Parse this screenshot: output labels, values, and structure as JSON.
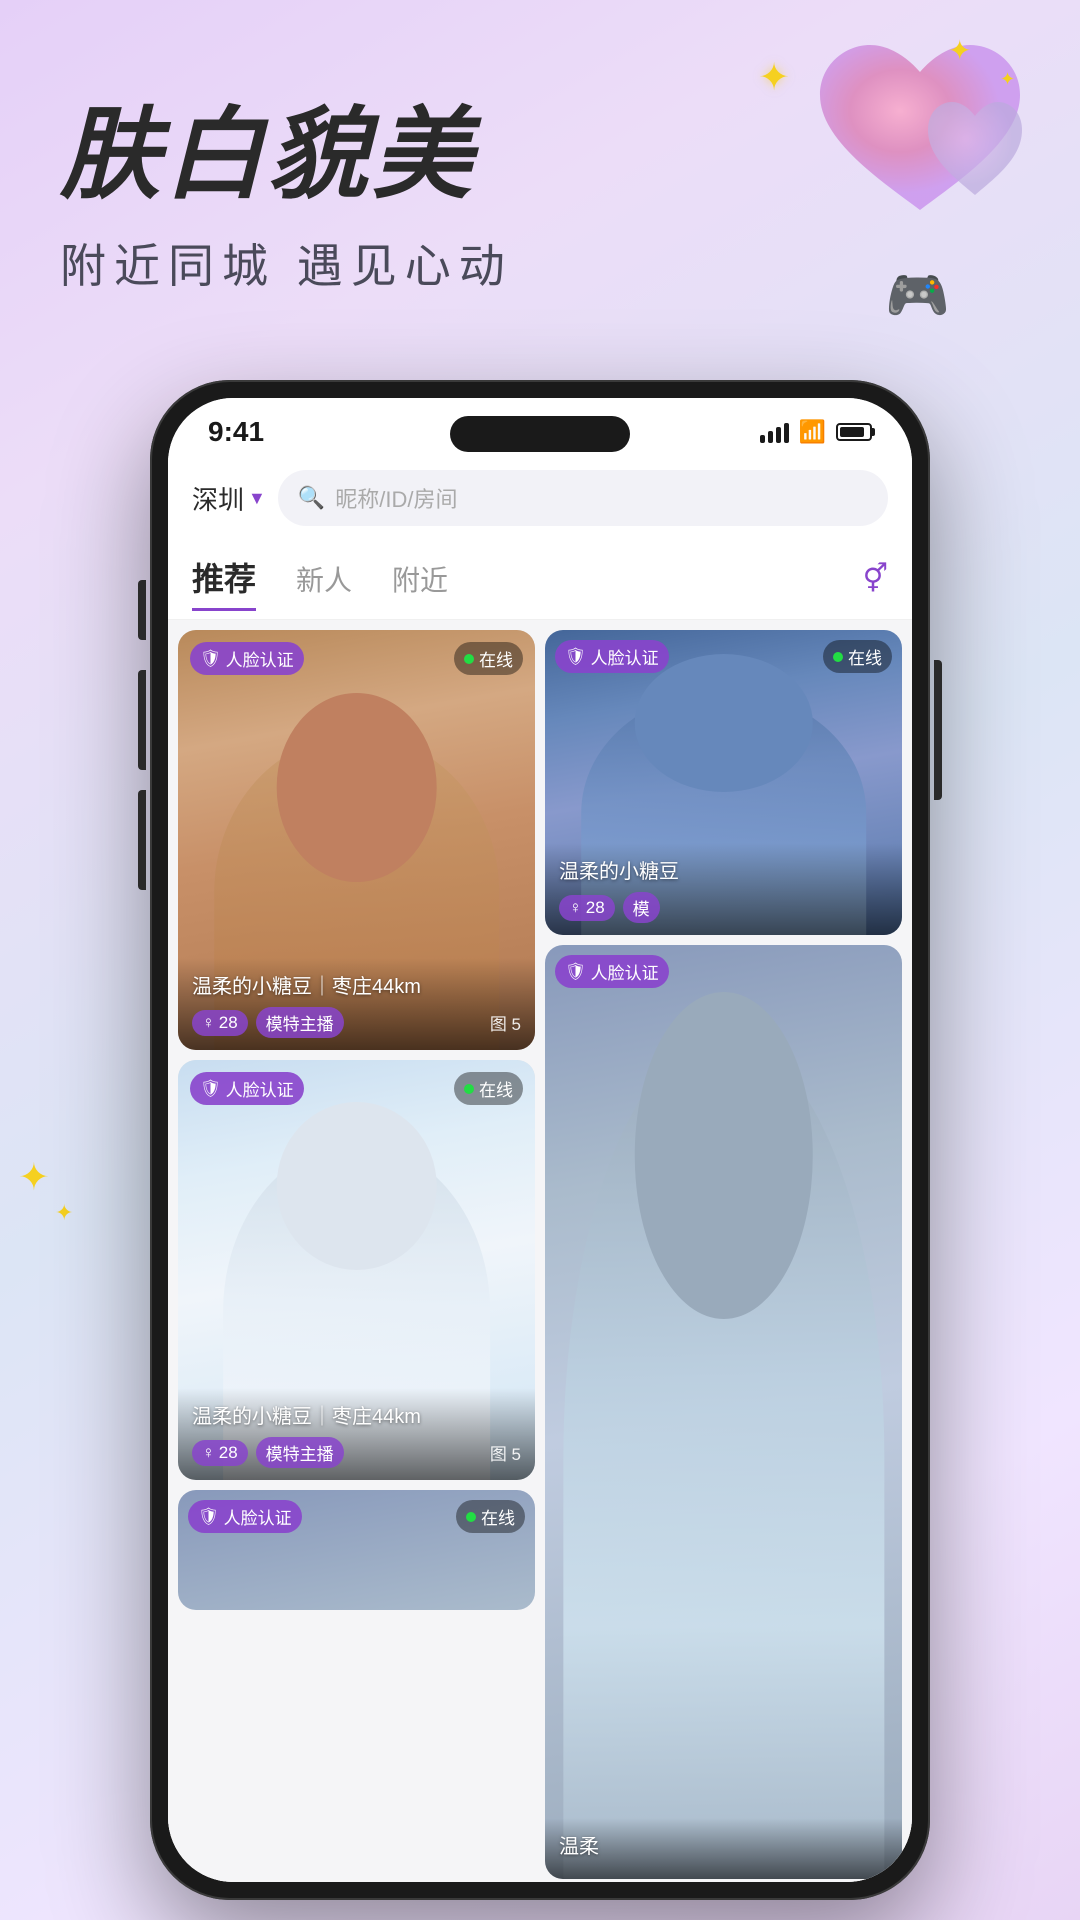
{
  "app": {
    "title": "肤白貌美",
    "subtitle": "附近同城 遇见心动",
    "status_time": "9:41"
  },
  "search": {
    "location": "深圳",
    "placeholder": "昵称/ID/房间"
  },
  "tabs": [
    {
      "id": "recommend",
      "label": "推荐",
      "active": true
    },
    {
      "id": "newbie",
      "label": "新人",
      "active": false
    },
    {
      "id": "nearby",
      "label": "附近",
      "active": false
    }
  ],
  "cards": [
    {
      "id": "card1",
      "name": "温柔的小糖豆｜枣庄44km",
      "verified_label": "人脸认证",
      "online_label": "在线",
      "age": "28",
      "tag": "模特主播",
      "photo_count": "图 5",
      "column": "left",
      "size": "tall"
    },
    {
      "id": "card2",
      "name": "温柔的小糖豆",
      "verified_label": "人脸认证",
      "online_label": "在线",
      "age": "28",
      "tag": "模",
      "column": "right-top",
      "size": "short"
    },
    {
      "id": "card3",
      "name": "温柔的小糖豆｜枣庄44km",
      "verified_label": "人脸认证",
      "online_label": "在线",
      "age": "28",
      "tag": "模特主播",
      "photo_count": "图 5",
      "column": "left",
      "size": "tall"
    },
    {
      "id": "card4",
      "name": "温柔",
      "verified_label": "人脸认证",
      "column": "right-bottom",
      "size": "tall"
    }
  ],
  "icons": {
    "shield": "🛡",
    "person": "♀",
    "gender": "⚥",
    "search": "🔍"
  }
}
